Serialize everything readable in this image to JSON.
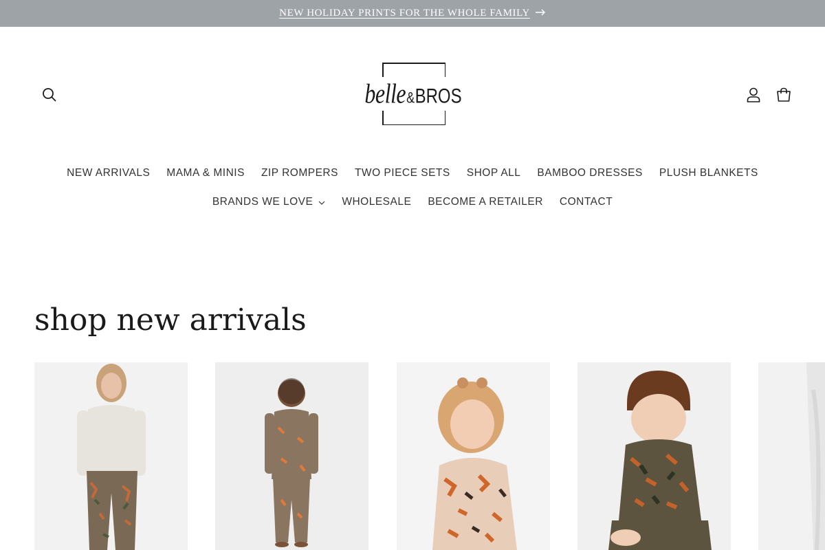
{
  "announcement": {
    "text": "NEW HOLIDAY PRINTS FOR THE WHOLE FAMILY",
    "arrow_icon": "arrow-right-icon"
  },
  "header": {
    "logo": {
      "text_script": "belle",
      "text_amp": "&",
      "text_caps": "BROS"
    },
    "icons": {
      "search": "search-icon",
      "account": "account-icon",
      "cart": "cart-icon"
    }
  },
  "nav": {
    "row1": [
      {
        "label": "NEW ARRIVALS"
      },
      {
        "label": "MAMA & MINIS"
      },
      {
        "label": "ZIP ROMPERS"
      },
      {
        "label": "TWO PIECE SETS"
      },
      {
        "label": "SHOP ALL"
      },
      {
        "label": "BAMBOO DRESSES"
      },
      {
        "label": "PLUSH BLANKETS"
      }
    ],
    "row2": [
      {
        "label": "BRANDS WE LOVE",
        "has_dropdown": true
      },
      {
        "label": "WHOLESALE"
      },
      {
        "label": "BECOME A RETAILER"
      },
      {
        "label": "CONTACT"
      }
    ]
  },
  "main": {
    "section_title": "shop new arrivals",
    "products": [
      {
        "image": "woman in white top and print pajama pants"
      },
      {
        "image": "toddler boy in butterfly print two piece set"
      },
      {
        "image": "toddler girl in butterfly print pajamas"
      },
      {
        "image": "baby in brown beanie and camo zip romper"
      },
      {
        "image": "partial product image"
      }
    ]
  },
  "colors": {
    "announcement_bg": "#9ea3a8",
    "text": "#1a1a1a",
    "nav_text": "#333333"
  }
}
